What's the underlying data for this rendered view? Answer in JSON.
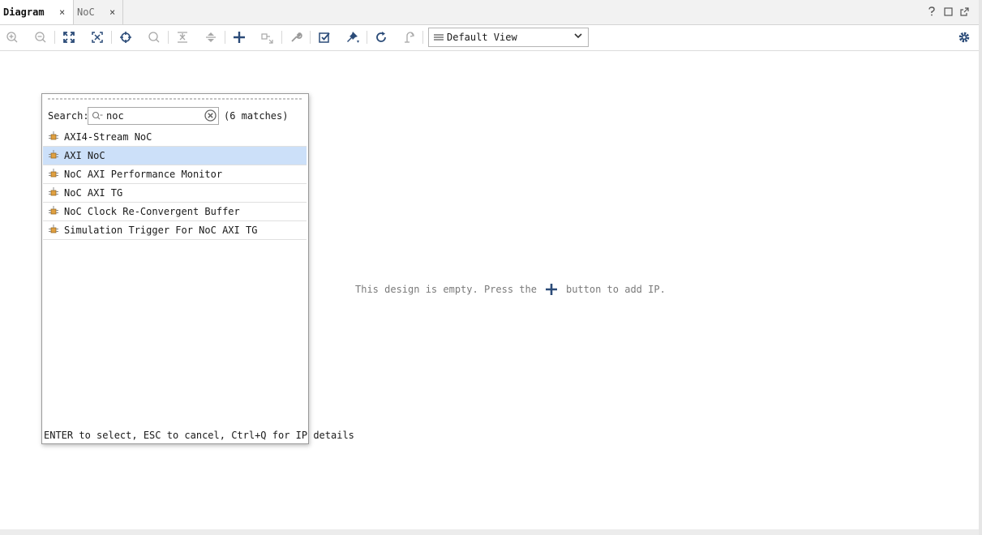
{
  "tabs": [
    {
      "label": "Diagram",
      "active": true
    },
    {
      "label": "NoC",
      "active": false
    }
  ],
  "tab_close_glyph": "×",
  "window_buttons": [
    "help-icon",
    "maximize-icon",
    "float-icon"
  ],
  "toolbar": {
    "buttons": [
      "zoom-in-icon",
      "zoom-out-icon",
      "zoom-fit-icon",
      "fit-selection-icon",
      "auto-connect-icon",
      "search-icon",
      "collapse-icon",
      "expand-icon",
      "add-ip-icon",
      "make-connection-icon",
      "properties-icon",
      "validate-icon",
      "pin-icon",
      "regenerate-icon",
      "optional-icon",
      "settings-icon"
    ],
    "view_select": "Default View"
  },
  "canvas": {
    "empty_prefix": "This design is empty. Press the",
    "empty_suffix": "button to add IP."
  },
  "popup": {
    "search_label": "Search:",
    "search_value": "noc",
    "matches": "(6 matches)",
    "items": [
      {
        "label": "AXI4-Stream NoC",
        "selected": false
      },
      {
        "label": "AXI NoC",
        "selected": true
      },
      {
        "label": "NoC AXI Performance Monitor",
        "selected": false
      },
      {
        "label": "NoC AXI TG",
        "selected": false
      },
      {
        "label": "NoC Clock Re-Convergent Buffer",
        "selected": false
      },
      {
        "label": "Simulation Trigger For NoC AXI TG",
        "selected": false
      }
    ],
    "footer": "ENTER to select, ESC to cancel, Ctrl+Q for IP details"
  },
  "colors": {
    "selection": "#cce0f9",
    "icon_blue": "#2b4b78",
    "ip_orange": "#e0a040"
  }
}
